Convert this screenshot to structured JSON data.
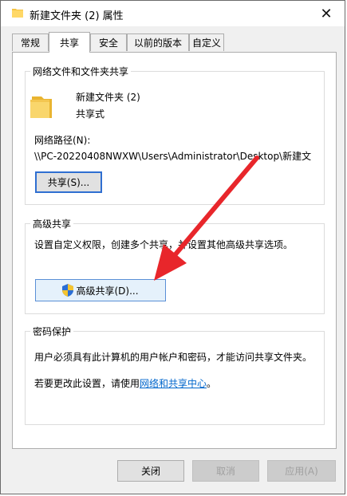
{
  "window": {
    "title": "新建文件夹 (2) 属性",
    "close_glyph": "✕"
  },
  "tabs": [
    {
      "label": "常规",
      "active": false
    },
    {
      "label": "共享",
      "active": true
    },
    {
      "label": "安全",
      "active": false
    },
    {
      "label": "以前的版本",
      "active": false
    },
    {
      "label": "自定义",
      "active": false
    }
  ],
  "network_share": {
    "group_title": "网络文件和文件夹共享",
    "folder_name": "新建文件夹 (2)",
    "share_status": "共享式",
    "path_label": "网络路径(N):",
    "path_value": "\\\\PC-20220408NWXW\\Users\\Administrator\\Desktop\\新建文",
    "share_button": "共享(S)..."
  },
  "advanced_share": {
    "group_title": "高级共享",
    "description": "设置自定义权限，创建多个共享，并设置其他高级共享选项。",
    "button": "高级共享(D)..."
  },
  "password": {
    "group_title": "密码保护",
    "description": "用户必须具有此计算机的用户帐户和密码，才能访问共享文件夹。",
    "change_prefix": "若要更改此设置，请使用",
    "change_link": "网络和共享中心",
    "change_suffix": "。"
  },
  "footer": {
    "close": "关闭",
    "cancel": "取消",
    "apply": "应用(A)"
  },
  "colors": {
    "arrow": "#e8262b",
    "link": "#0066cc",
    "folder": "#f5c342"
  }
}
